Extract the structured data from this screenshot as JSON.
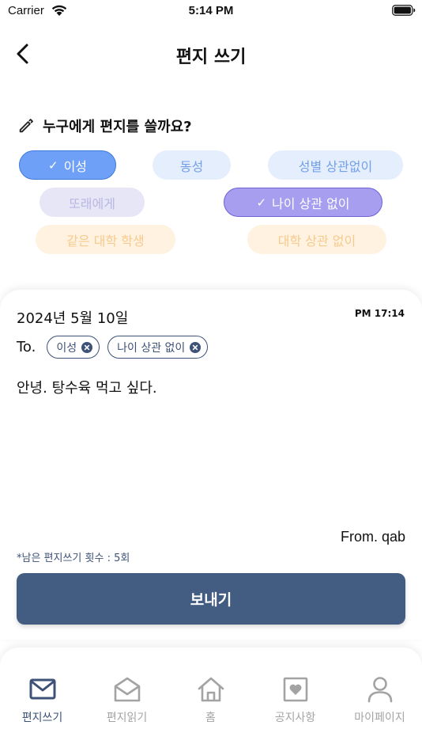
{
  "status_bar": {
    "carrier": "Carrier",
    "time": "5:14 PM"
  },
  "header": {
    "title": "편지 쓰기"
  },
  "question": {
    "text": "누구에게 편지를 쓸까요?"
  },
  "filters": [
    {
      "label": "이성",
      "selected": true
    },
    {
      "label": "동성",
      "selected": false
    },
    {
      "label": "성별 상관없이",
      "selected": false
    },
    {
      "label": "또래에게",
      "selected": false
    },
    {
      "label": "나이 상관 없이",
      "selected": true
    },
    {
      "label": "같은 대학 학생",
      "selected": false
    },
    {
      "label": "대학 상관 없이",
      "selected": false
    }
  ],
  "letter": {
    "date": "2024년 5월 10일",
    "time": "PM 17:14",
    "to_label": "To.",
    "tags": [
      "이성",
      "나이 상관 없이"
    ],
    "body": "안녕. 탕수육 먹고 싶다.",
    "from": "From. qab",
    "remaining": "*남은 편지쓰기 횟수 : 5회"
  },
  "send_button": {
    "label": "보내기"
  },
  "tabs": [
    {
      "label": "편지쓰기",
      "icon": "mail-icon",
      "active": true
    },
    {
      "label": "편지읽기",
      "icon": "open-mail-icon",
      "active": false
    },
    {
      "label": "홈",
      "icon": "home-icon",
      "active": false
    },
    {
      "label": "공지사항",
      "icon": "notice-heart-icon",
      "active": false
    },
    {
      "label": "마이페이지",
      "icon": "user-icon",
      "active": false
    }
  ],
  "colors": {
    "primary": "#435c82",
    "active_tab": "#3e5277",
    "inactive_tab": "#a3a3a3"
  }
}
